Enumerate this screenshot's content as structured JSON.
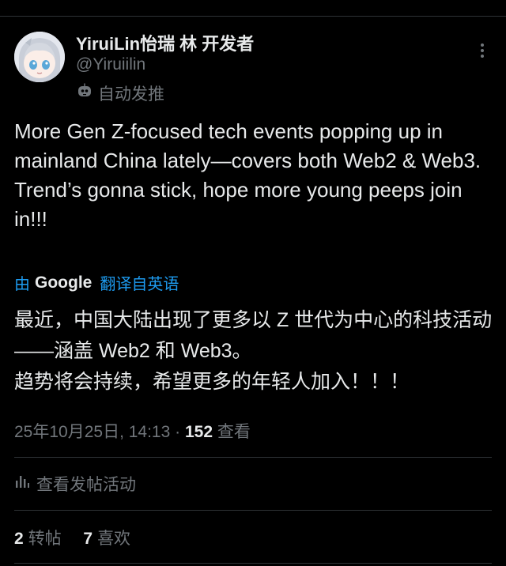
{
  "post": {
    "author": {
      "display_name": "YiruiLin怡瑞 林 开发者",
      "handle": "@Yiruiilin",
      "automated_label": "自动发推"
    },
    "text": "More Gen Z-focused tech events popping up in mainland China lately—covers both Web2 & Web3.\nTrend’s gonna stick, hope more young peeps join in!!!",
    "translation": {
      "by_label": "由",
      "provider": "Google",
      "link_label": "翻译自英语",
      "text": "最近，中国大陆出现了更多以 Z 世代为中心的科技活动——涵盖 Web2 和 Web3。\n趋势将会持续，希望更多的年轻人加入！！！"
    },
    "timestamp": "25年10月25日, 14:13",
    "separator": "·",
    "views_count": "152",
    "views_label": "查看",
    "activity_label": "查看发帖活动",
    "stats": {
      "reposts_count": "2",
      "reposts_label": "转帖",
      "likes_count": "7",
      "likes_label": "喜欢"
    }
  },
  "icons": {
    "more": "more-vertical-icon",
    "automated": "bot-icon",
    "activity": "bar-chart-icon"
  }
}
